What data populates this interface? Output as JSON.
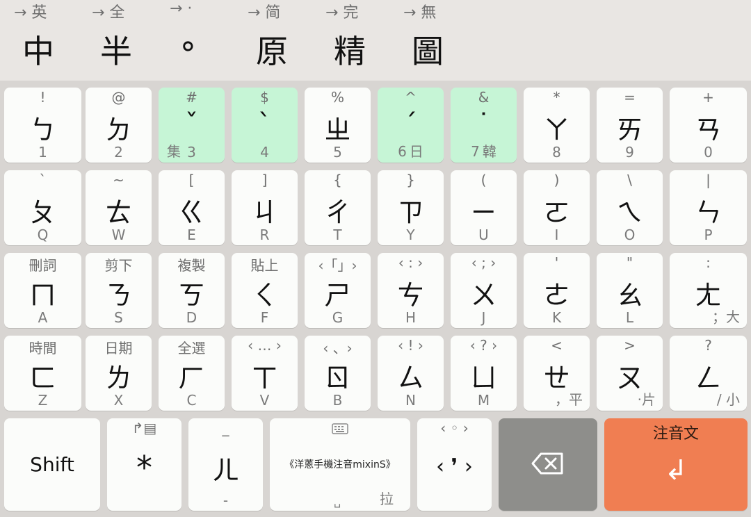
{
  "mode_bar": [
    {
      "hint": "→ 英",
      "label": "中"
    },
    {
      "hint": "→ 全",
      "label": "半"
    },
    {
      "hint": "→ ·",
      "label": "∘"
    },
    {
      "hint": "→ 简",
      "label": "原"
    },
    {
      "hint": "→ 完",
      "label": "精"
    },
    {
      "hint": "→ 無",
      "label": "圖"
    }
  ],
  "rows": [
    [
      {
        "top": "!",
        "main": "ㄅ",
        "bot": "1"
      },
      {
        "top": "@",
        "main": "ㄉ",
        "bot": "2"
      },
      {
        "top": "#",
        "main": "ˇ",
        "bot": "3",
        "botl": "集",
        "green": true
      },
      {
        "top": "$",
        "main": "ˋ",
        "bot": "4",
        "green": true
      },
      {
        "top": "%",
        "main": "ㄓ",
        "bot": "5"
      },
      {
        "top": "^",
        "main": "ˊ",
        "bot": "6",
        "botx": "日",
        "green": true
      },
      {
        "top": "&",
        "main": "˙",
        "bot": "7",
        "botx": "韓",
        "green": true
      },
      {
        "top": "*",
        "main": "ㄚ",
        "bot": "8"
      },
      {
        "top": "=",
        "main": "ㄞ",
        "bot": "9"
      },
      {
        "top": "+",
        "main": "ㄢ",
        "bot": "0"
      }
    ],
    [
      {
        "top": "`",
        "main": "ㄆ",
        "bot": "Q"
      },
      {
        "top": "~",
        "main": "ㄊ",
        "bot": "W"
      },
      {
        "top": "[",
        "main": "ㄍ",
        "bot": "E"
      },
      {
        "top": "]",
        "main": "ㄐ",
        "bot": "R"
      },
      {
        "top": "{",
        "main": "ㄔ",
        "bot": "T"
      },
      {
        "top": "}",
        "main": "ㄗ",
        "bot": "Y"
      },
      {
        "top": "(",
        "main": "ㄧ",
        "bot": "U"
      },
      {
        "top": ")",
        "main": "ㄛ",
        "bot": "I"
      },
      {
        "top": "\\",
        "main": "ㄟ",
        "bot": "O"
      },
      {
        "top": "|",
        "main": "ㄣ",
        "bot": "P"
      }
    ],
    [
      {
        "top": "刪詞",
        "main": "ㄇ",
        "bot": "A"
      },
      {
        "top": "剪下",
        "main": "ㄋ",
        "bot": "S"
      },
      {
        "top": "複製",
        "main": "ㄎ",
        "bot": "D"
      },
      {
        "top": "貼上",
        "main": "ㄑ",
        "bot": "F"
      },
      {
        "top": "‹「」›",
        "main": "ㄕ",
        "bot": "G"
      },
      {
        "top": "‹ : ›",
        "main": "ㄘ",
        "bot": "H"
      },
      {
        "top": "‹ ; ›",
        "main": "ㄨ",
        "bot": "J"
      },
      {
        "top": "'",
        "main": "ㄜ",
        "bot": "K"
      },
      {
        "top": "\"",
        "main": "ㄠ",
        "bot": "L"
      },
      {
        "top": ":",
        "main": "ㄤ",
        "botr": "；大"
      }
    ],
    [
      {
        "top": "時間",
        "main": "ㄈ",
        "bot": "Z"
      },
      {
        "top": "日期",
        "main": "ㄌ",
        "bot": "X"
      },
      {
        "top": "全選",
        "main": "ㄏ",
        "bot": "C"
      },
      {
        "top": "‹ … ›",
        "main": "ㄒ",
        "bot": "V"
      },
      {
        "top": "‹ 、›",
        "main": "ㄖ",
        "bot": "B"
      },
      {
        "top": "‹ ! ›",
        "main": "ㄙ",
        "bot": "N"
      },
      {
        "top": "‹ ? ›",
        "main": "ㄩ",
        "bot": "M"
      },
      {
        "top": "<",
        "main": "ㄝ",
        "botr": "，平"
      },
      {
        "top": ">",
        "main": "ㄡ",
        "botr": "·片"
      },
      {
        "top": "?",
        "main": "ㄥ",
        "botr": "/ 小"
      }
    ]
  ],
  "bottom_row": {
    "shift": {
      "label": "Shift"
    },
    "star": {
      "top": "↱▤",
      "main": "*"
    },
    "er": {
      "top": "_",
      "main": "ㄦ",
      "bot": "-"
    },
    "space": {
      "top_icon": "⌨",
      "label": "《洋蔥手機注音mixinS》",
      "bot": "拉",
      "corner": "␣"
    },
    "punct": {
      "top": "‹ ◦ ›",
      "main": "‹ ❜ ›"
    },
    "backspace": {
      "icon": "⌫"
    },
    "enter": {
      "top": "注音文",
      "main": "↲"
    }
  },
  "colors": {
    "green_key": "#c6f5d6",
    "delete_key": "#8e8e8b",
    "enter_key": "#f07e52"
  }
}
